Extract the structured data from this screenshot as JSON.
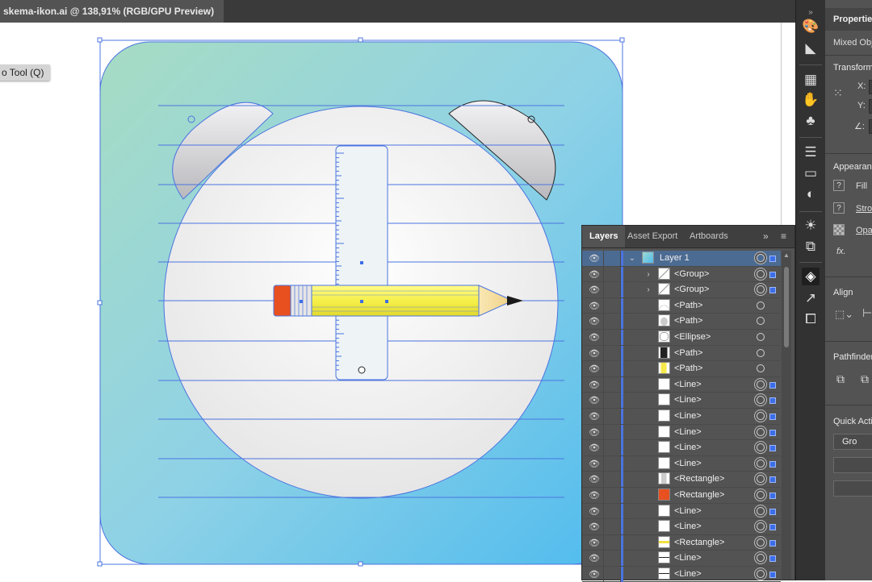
{
  "document_tab": {
    "title": "skema-ikon.ai @ 138,91% (RGB/GPU Preview)"
  },
  "tooltip": {
    "text": "o Tool (Q)"
  },
  "toolstrip": {
    "icons": [
      "palette-icon",
      "fill-icon",
      "align-grid-icon",
      "puppet-icon",
      "club-icon",
      "lines-icon",
      "gradient-icon",
      "shapes-icon",
      "sun-icon",
      "transform-icon",
      "layers-icon",
      "export-icon",
      "artboard-icon"
    ],
    "active": "layers-icon"
  },
  "properties": {
    "tab": "Properties",
    "mixed_label": "Mixed Obje",
    "transform_head": "Transform",
    "x_label": "X:",
    "y_label": "Y:",
    "angle_label": "∠:",
    "appearance_head": "Appearanc",
    "fill_label": "Fill",
    "stroke_label": "Strok",
    "opacity_label": "Opac",
    "fx_label": "fx.",
    "align_head": "Align",
    "pathfinder_head": "Pathfinder",
    "quick_actions_head": "Quick Actio",
    "group_button": "Gro"
  },
  "layers_panel": {
    "tabs": [
      "Layers",
      "Asset Export",
      "Artboards"
    ],
    "active_tab": "Layers",
    "menu_glyph": "≡",
    "collapse_glyph": "»",
    "rows": [
      {
        "name": "Layer 1",
        "level": 0,
        "expand": "open",
        "thumb": "layer",
        "sel": true,
        "highlight": true
      },
      {
        "name": "<Group>",
        "level": 1,
        "expand": "closed",
        "thumb": "diag",
        "sel": true,
        "highlight": false
      },
      {
        "name": "<Group>",
        "level": 1,
        "expand": "closed",
        "thumb": "diag",
        "sel": true,
        "highlight": false
      },
      {
        "name": "<Path>",
        "level": 1,
        "expand": "",
        "thumb": "arc",
        "sel": false,
        "highlight": false
      },
      {
        "name": "<Path>",
        "level": 1,
        "expand": "",
        "thumb": "cloud",
        "sel": false,
        "highlight": false
      },
      {
        "name": "<Ellipse>",
        "level": 1,
        "expand": "",
        "thumb": "ellipse",
        "sel": false,
        "highlight": false
      },
      {
        "name": "<Path>",
        "level": 1,
        "expand": "",
        "thumb": "tip",
        "sel": false,
        "highlight": false
      },
      {
        "name": "<Path>",
        "level": 1,
        "expand": "",
        "thumb": "yellowtip",
        "sel": false,
        "highlight": false
      },
      {
        "name": "<Line>",
        "level": 1,
        "expand": "",
        "thumb": "blank",
        "sel": true,
        "highlight": false
      },
      {
        "name": "<Line>",
        "level": 1,
        "expand": "",
        "thumb": "blank",
        "sel": true,
        "highlight": false
      },
      {
        "name": "<Line>",
        "level": 1,
        "expand": "",
        "thumb": "blank",
        "sel": true,
        "highlight": false
      },
      {
        "name": "<Line>",
        "level": 1,
        "expand": "",
        "thumb": "blank",
        "sel": true,
        "highlight": false
      },
      {
        "name": "<Line>",
        "level": 1,
        "expand": "",
        "thumb": "blank",
        "sel": true,
        "highlight": false
      },
      {
        "name": "<Line>",
        "level": 1,
        "expand": "",
        "thumb": "blank",
        "sel": true,
        "highlight": false
      },
      {
        "name": "<Rectangle>",
        "level": 1,
        "expand": "",
        "thumb": "grayrect",
        "sel": true,
        "highlight": false
      },
      {
        "name": "<Rectangle>",
        "level": 1,
        "expand": "",
        "thumb": "orange",
        "sel": true,
        "highlight": false
      },
      {
        "name": "<Line>",
        "level": 1,
        "expand": "",
        "thumb": "blank",
        "sel": true,
        "highlight": false
      },
      {
        "name": "<Line>",
        "level": 1,
        "expand": "",
        "thumb": "blank",
        "sel": true,
        "highlight": false
      },
      {
        "name": "<Rectangle>",
        "level": 1,
        "expand": "",
        "thumb": "yellowline",
        "sel": true,
        "highlight": false
      },
      {
        "name": "<Line>",
        "level": 1,
        "expand": "",
        "thumb": "hline",
        "sel": true,
        "highlight": false
      },
      {
        "name": "<Line>",
        "level": 1,
        "expand": "",
        "thumb": "hline",
        "sel": true,
        "highlight": false
      }
    ]
  },
  "colors": {
    "selection": "#4b74e0",
    "bg_gradient_start": "#a7dcc3",
    "bg_gradient_end": "#5ac0ec",
    "pencil_yellow": "#f6f04a",
    "eraser_orange": "#e8501f"
  }
}
